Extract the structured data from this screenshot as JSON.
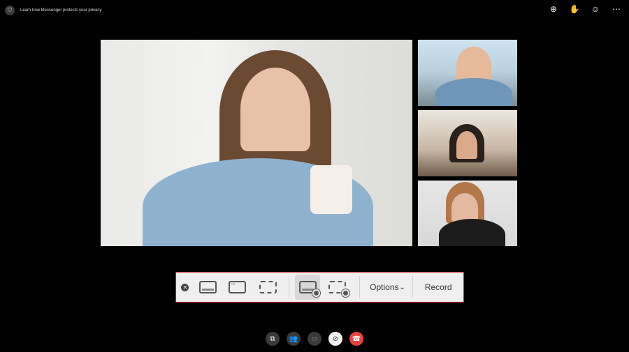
{
  "header": {
    "privacy_text": "Learn how Messenger protects your privacy",
    "icons": [
      "add-icon",
      "wave-icon",
      "effects-icon",
      "more-icon"
    ]
  },
  "videos": {
    "main": "main-participant",
    "tiles": [
      "participant-2",
      "participant-3",
      "participant-4"
    ]
  },
  "toolbar": {
    "options_label": "Options",
    "options_chevron": "⌄",
    "record_label": "Record"
  },
  "controls": [
    "share-screen",
    "participants",
    "camera-off",
    "mute",
    "end-call"
  ],
  "colors": {
    "toolbar_border": "#c9252b",
    "end_call": "#e8433f"
  }
}
